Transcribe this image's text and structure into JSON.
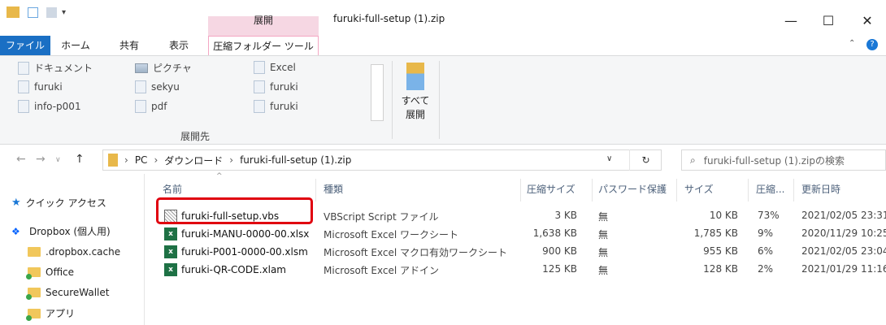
{
  "window": {
    "title": "furuki-full-setup (1).zip",
    "context_group": "展開",
    "buttons": {
      "minimize": "—",
      "maximize": "☐",
      "close": "✕"
    }
  },
  "ribbon_tabs": [
    {
      "label": "ファイル"
    },
    {
      "label": "ホーム"
    },
    {
      "label": "共有"
    },
    {
      "label": "表示"
    },
    {
      "label": "圧縮フォルダー ツール"
    }
  ],
  "ribbon": {
    "destinations_col1": [
      "ドキュメント",
      "furuki",
      "info-p001"
    ],
    "destinations_col2": [
      "ピクチャ",
      "sekyu",
      "pdf"
    ],
    "destinations_col3": [
      "Excel",
      "furuki",
      "furuki"
    ],
    "group_label": "展開先",
    "extract_all": [
      "すべて",
      "展開"
    ]
  },
  "address": {
    "parts": [
      "PC",
      "ダウンロード",
      "furuki-full-setup (1).zip"
    ],
    "search_placeholder": "furuki-full-setup (1).zipの検索"
  },
  "nav_pane": {
    "items": [
      {
        "label": "クイック アクセス",
        "icon": "star-icon"
      },
      {
        "label": "Dropbox (個人用)",
        "icon": "dropbox-icon"
      },
      {
        "label": ".dropbox.cache",
        "icon": "folder-icon"
      },
      {
        "label": "Office",
        "icon": "folder-sync-icon"
      },
      {
        "label": "SecureWallet",
        "icon": "folder-sync-icon"
      },
      {
        "label": "アプリ",
        "icon": "folder-sync-icon"
      }
    ]
  },
  "columns": {
    "name": "名前",
    "type": "種類",
    "compressed": "圧縮サイズ",
    "password": "パスワード保護",
    "size": "サイズ",
    "ratio": "圧縮...",
    "modified": "更新日時"
  },
  "files": [
    {
      "name": "furuki-full-setup.vbs",
      "type": "VBScript Script ファイル",
      "compressed": "3 KB",
      "password": "無",
      "size": "10 KB",
      "ratio": "73%",
      "modified": "2021/02/05 23:31",
      "icon": "vbs-file-icon"
    },
    {
      "name": "furuki-MANU-0000-00.xlsx",
      "type": "Microsoft Excel ワークシート",
      "compressed": "1,638 KB",
      "password": "無",
      "size": "1,785 KB",
      "ratio": "9%",
      "modified": "2020/11/29 10:25",
      "icon": "excel-file-icon"
    },
    {
      "name": "furuki-P001-0000-00.xlsm",
      "type": "Microsoft Excel マクロ有効ワークシート",
      "compressed": "900 KB",
      "password": "無",
      "size": "955 KB",
      "ratio": "6%",
      "modified": "2021/02/05 23:04",
      "icon": "excel-macro-file-icon"
    },
    {
      "name": "furuki-QR-CODE.xlam",
      "type": "Microsoft Excel アドイン",
      "compressed": "125 KB",
      "password": "無",
      "size": "128 KB",
      "ratio": "2%",
      "modified": "2021/01/29 11:16",
      "icon": "excel-addin-file-icon"
    }
  ],
  "highlight_color": "#e0000f"
}
